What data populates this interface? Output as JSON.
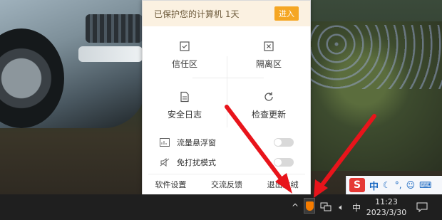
{
  "popup": {
    "header_text": "已保护您的计算机 1天",
    "enter_button": "进入",
    "grid": [
      {
        "label": "信任区",
        "icon": "trust-check-icon"
      },
      {
        "label": "隔离区",
        "icon": "quarantine-x-icon"
      },
      {
        "label": "安全日志",
        "icon": "log-document-icon"
      },
      {
        "label": "检查更新",
        "icon": "refresh-icon"
      }
    ],
    "toggles": [
      {
        "label": "流量悬浮窗",
        "icon": "traffic-chart-icon",
        "on": false
      },
      {
        "label": "免打扰模式",
        "icon": "mute-bell-icon",
        "on": false
      }
    ],
    "footer": [
      "软件设置",
      "交流反馈",
      "退出火绒"
    ]
  },
  "langbar": {
    "ime_logo": "S",
    "mode": "中",
    "icons": [
      "moon-icon",
      "punctuation-icon",
      "emoji-icon",
      "keyboard-icon"
    ]
  },
  "taskbar": {
    "tray": [
      "show-hidden-icons-chevron",
      "huorong-shield-icon",
      "network-icon",
      "volume-icon"
    ],
    "input_method": "中",
    "time": "11:23",
    "date": "2023/3/30",
    "notification": "notification-icon"
  },
  "colors": {
    "panel_header_bg": "#fbf1e1",
    "enter_button_bg": "#f5a623",
    "arrow": "#e8141b",
    "taskbar_bg": "#1f1f1f"
  }
}
